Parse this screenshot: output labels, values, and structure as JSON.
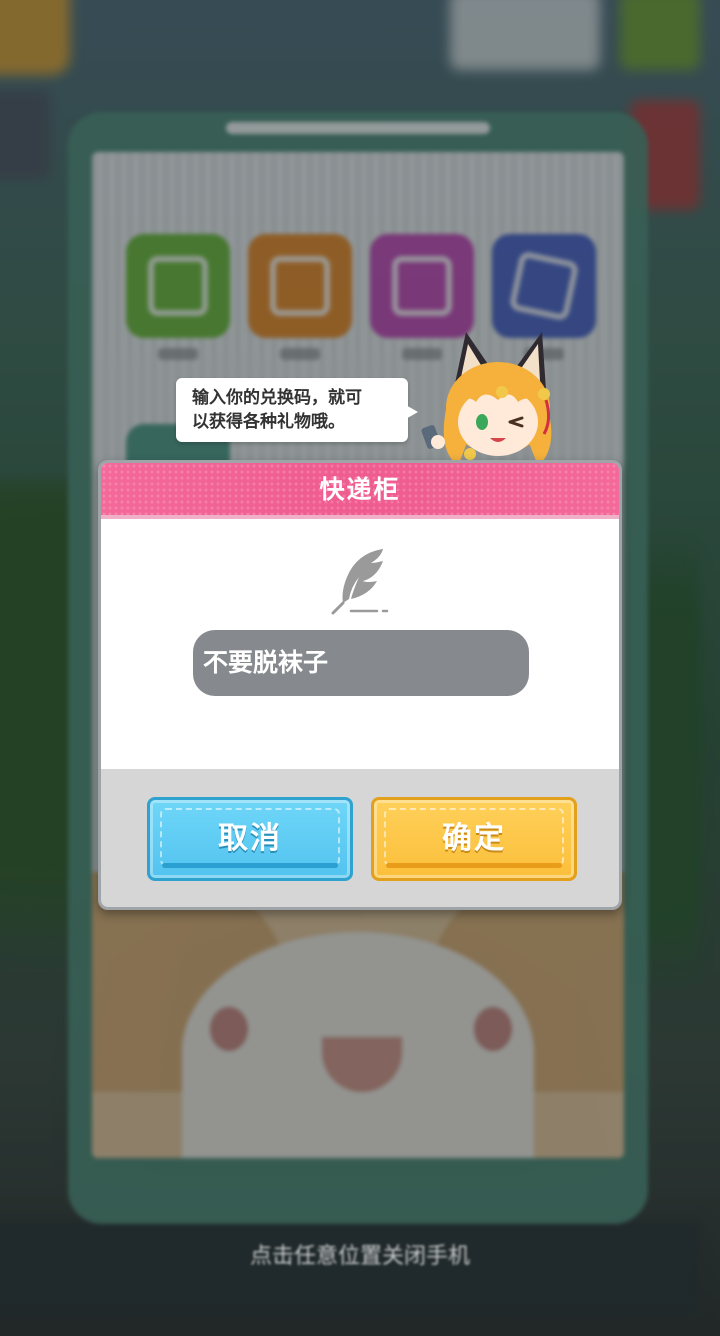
{
  "tooltip": {
    "line1": "输入你的兑换码，就可",
    "line2": "以获得各种礼物哦。"
  },
  "dialog": {
    "title": "快递柜",
    "input_value": "不要脱袜子",
    "cancel_label": "取消",
    "confirm_label": "确定"
  },
  "background": {
    "apps": [
      {
        "icon": "chat-icon",
        "color": "#6ab83a"
      },
      {
        "icon": "gift-icon",
        "color": "#e68a2a"
      },
      {
        "icon": "camera-icon",
        "color": "#c24ab8"
      },
      {
        "icon": "card-icon",
        "color": "#4a62c8"
      }
    ],
    "bottom_hint": "点击任意位置关闭手机"
  },
  "colors": {
    "header_pink": "#f4699a",
    "cancel_blue": "#5ecbf2",
    "confirm_yellow": "#fdc646",
    "input_gray": "#86898d"
  }
}
